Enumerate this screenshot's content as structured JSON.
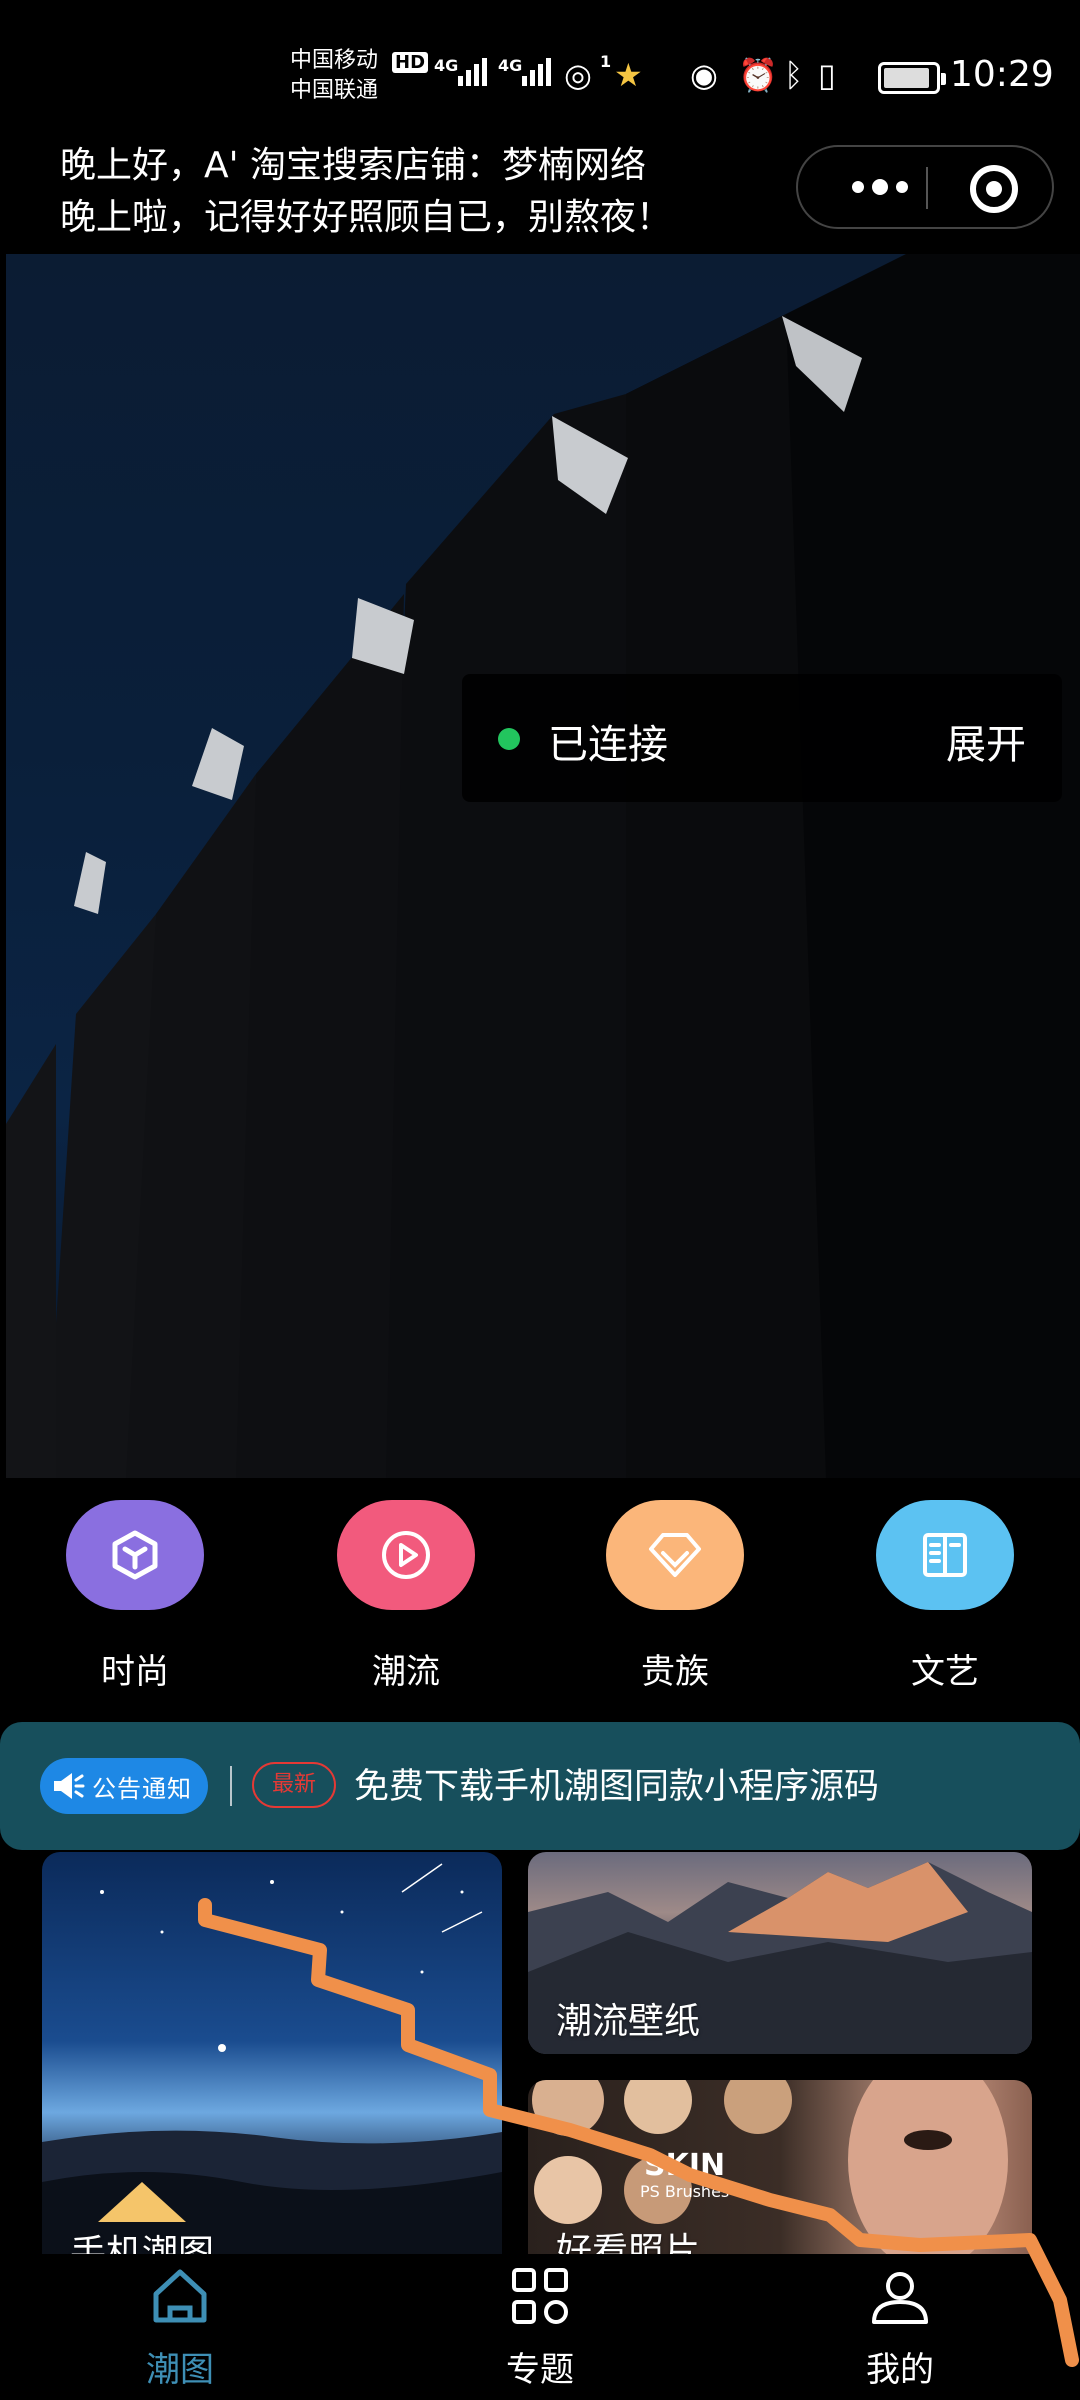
{
  "status_bar": {
    "carrier_1": "中国移动",
    "carrier_2": "中国联通",
    "hd": "HD",
    "net_1": "4G",
    "net_2": "4G",
    "hotspot_count": "1",
    "time": "10:29",
    "battery_level": 0.9
  },
  "header": {
    "greeting_line_1": "晚上好，A' 淘宝搜索店铺：梦楠网络",
    "greeting_line_2": "晚上啦，记得好好照顾自已，别熬夜！"
  },
  "hero": {
    "connection_status": "已连接",
    "expand_label": "展开"
  },
  "categories": [
    {
      "label": "时尚",
      "icon": "cube-icon",
      "color": "#8a6fe0"
    },
    {
      "label": "潮流",
      "icon": "play-circle-icon",
      "color": "#f25a7d"
    },
    {
      "label": "贵族",
      "icon": "diamond-icon",
      "color": "#fbb67a"
    },
    {
      "label": "文艺",
      "icon": "book-icon",
      "color": "#5cc2f2"
    }
  ],
  "notice": {
    "badge": "公告通知",
    "tag": "最新",
    "text": "免费下载手机潮图同款小程序源码"
  },
  "cards": [
    {
      "title": "手机潮图"
    },
    {
      "title": "潮流壁纸"
    },
    {
      "title": "好看照片",
      "image_text_1": "SKIN",
      "image_text_2": "PS Brushes"
    }
  ],
  "tabbar": {
    "items": [
      {
        "label": "潮图",
        "icon": "home-icon",
        "active": true
      },
      {
        "label": "专题",
        "icon": "grid-icon",
        "active": false
      },
      {
        "label": "我的",
        "icon": "user-icon",
        "active": false
      }
    ],
    "active_color": "#3e8fb5"
  }
}
